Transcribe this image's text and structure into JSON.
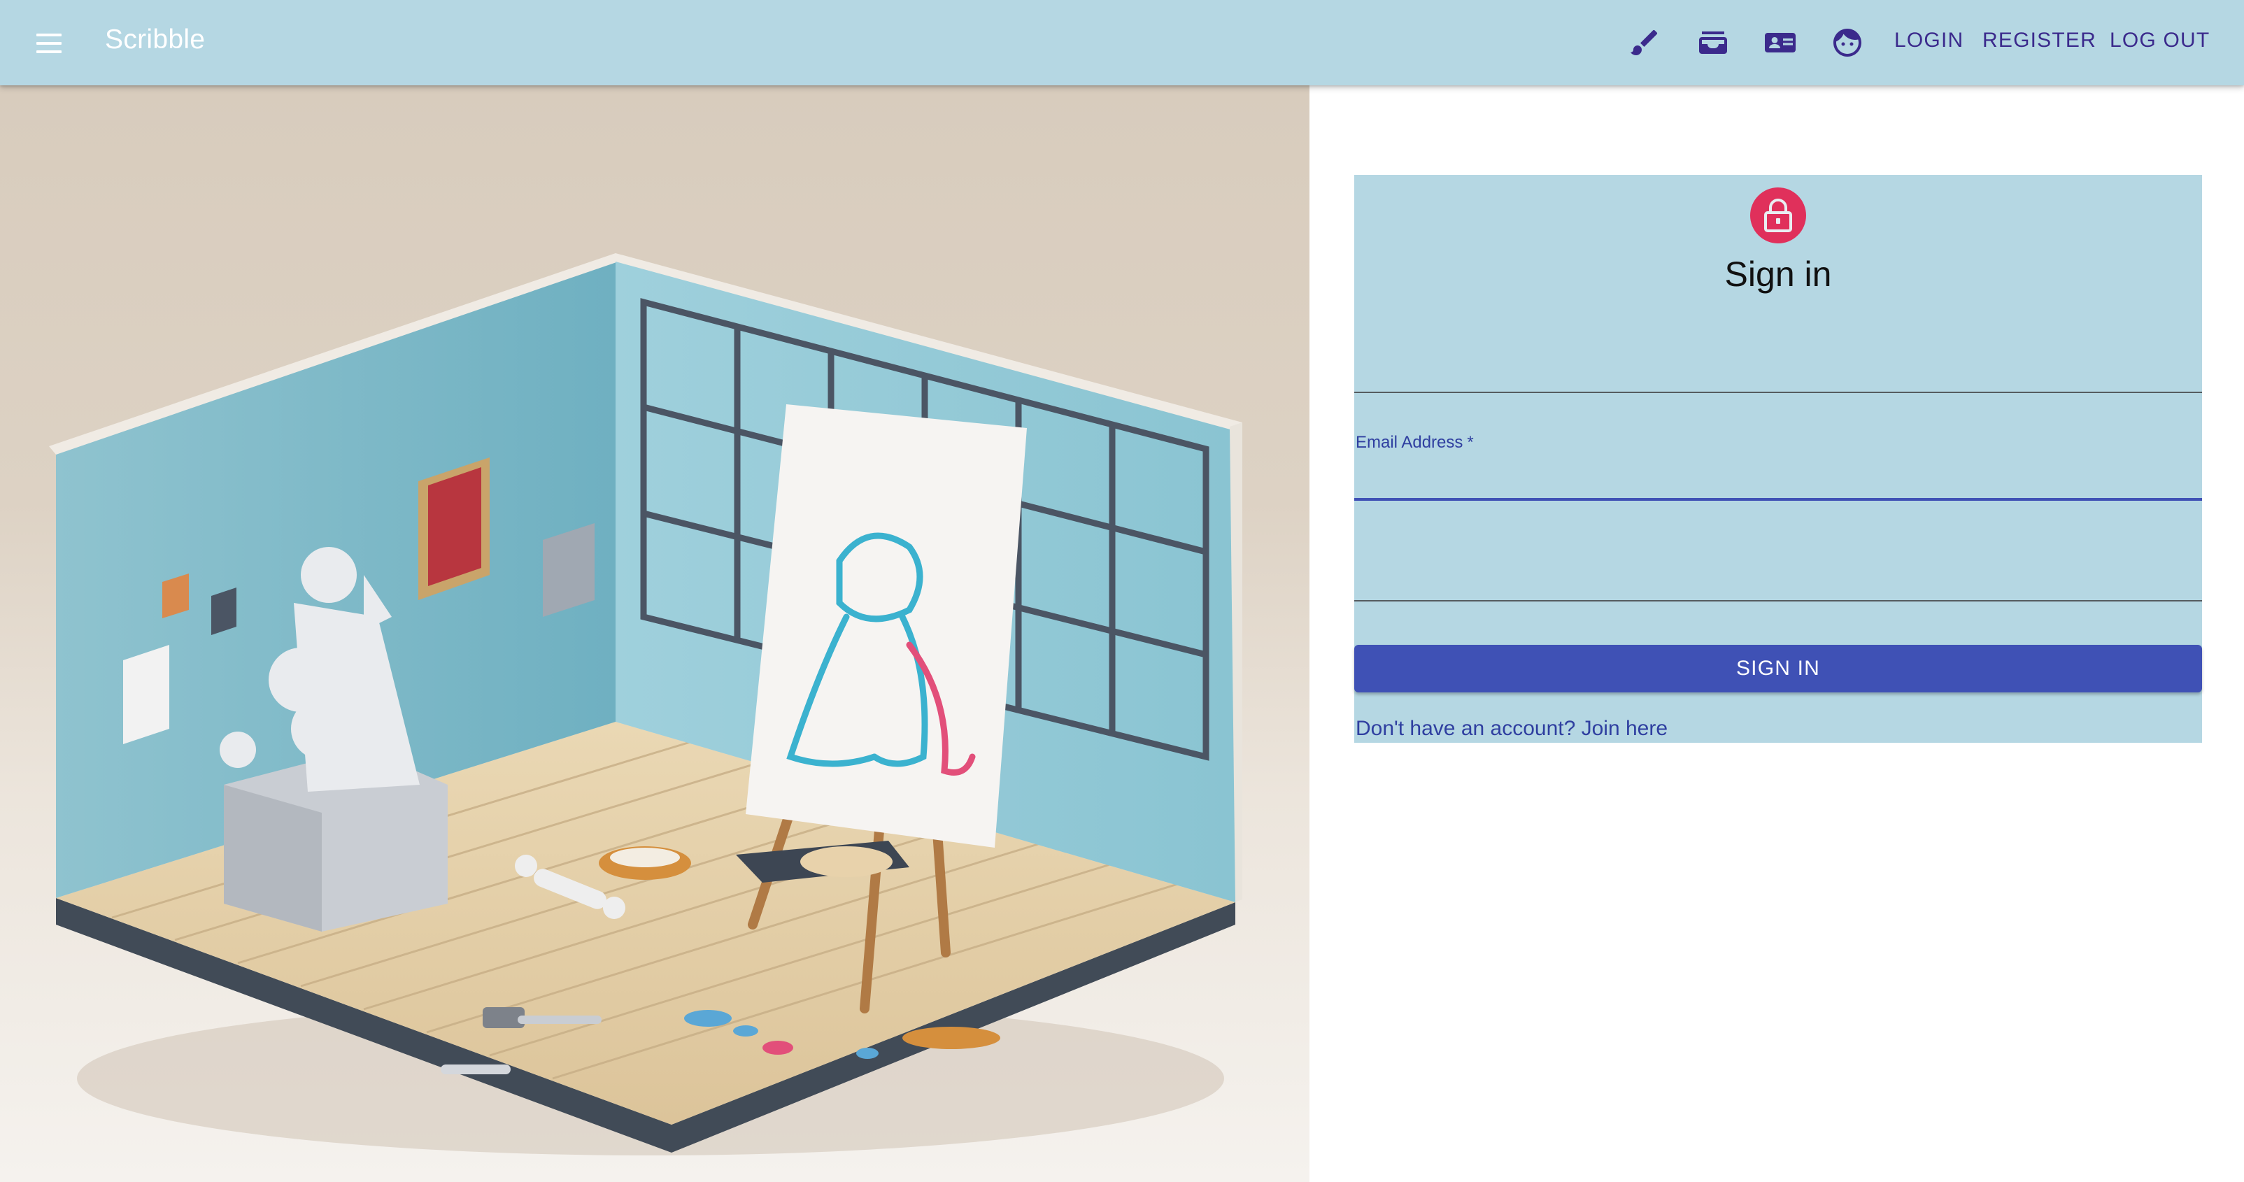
{
  "app": {
    "title": "Scribble",
    "menu_icon": "hamburger-menu-icon",
    "accent_color": "#3f51b5",
    "appbar_color": "#b5d7e3"
  },
  "nav": {
    "icons": [
      {
        "name": "paintbrush-icon",
        "label": "Draw"
      },
      {
        "name": "inbox-icon",
        "label": "Inbox"
      },
      {
        "name": "id-card-icon",
        "label": "Profile card"
      },
      {
        "name": "face-icon",
        "label": "Account"
      }
    ],
    "login": "LOGIN",
    "register": "REGISTER",
    "logout": "LOG OUT"
  },
  "hero": {
    "image": "isometric-art-studio-illustration"
  },
  "form": {
    "avatar_icon": "lock-icon",
    "avatar_color": "#e0305b",
    "title": "Sign in",
    "email_label": "Email Address",
    "email_required": "*",
    "email_value": "",
    "password_value": "",
    "submit_label": "SIGN IN",
    "join_link": "Don't have an account? Join here"
  }
}
